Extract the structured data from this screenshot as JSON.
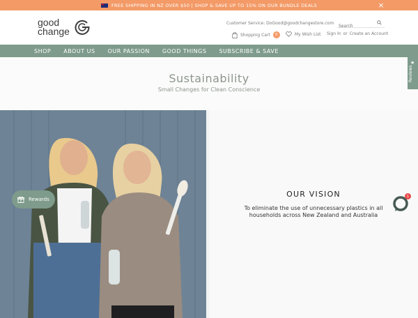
{
  "announcement": {
    "text": "FREE SHIPPING IN NZ OVER $50 | SHOP & SAVE UP TO 15% ON OUR BUNDLE DEALS",
    "flag_icon": "nz-flag-icon",
    "close_icon": "close-icon"
  },
  "header": {
    "logo_line1": "good",
    "logo_line2": "change",
    "customer_service": "Customer Service: DoGood@goodchangestore.com",
    "search_placeholder": "Search",
    "cart_label": "Shopping Cart",
    "cart_count": "0",
    "wishlist_label": "My Wish List",
    "signin_label": "Sign In",
    "or_label": "or",
    "create_account_label": "Create an Account"
  },
  "nav": {
    "items": [
      {
        "label": "SHOP"
      },
      {
        "label": "ABOUT US"
      },
      {
        "label": "OUR PASSION"
      },
      {
        "label": "GOOD THINGS"
      },
      {
        "label": "SUBSCRIBE & SAVE"
      }
    ]
  },
  "hero": {
    "title": "Sustainability",
    "subtitle": "Small Changes for Clean Conscience"
  },
  "reviews_tab": {
    "label": "Reviews"
  },
  "vision": {
    "title": "OUR VISION",
    "text": "To eliminate the use of unnecessary plastics in all households across New Zealand and Australia"
  },
  "rewards": {
    "label": "Rewards"
  },
  "chat": {
    "badge": "1"
  },
  "colors": {
    "announcement_bg": "#f39a67",
    "nav_bg": "#7e9b8b",
    "hero_text": "#8c968c"
  }
}
